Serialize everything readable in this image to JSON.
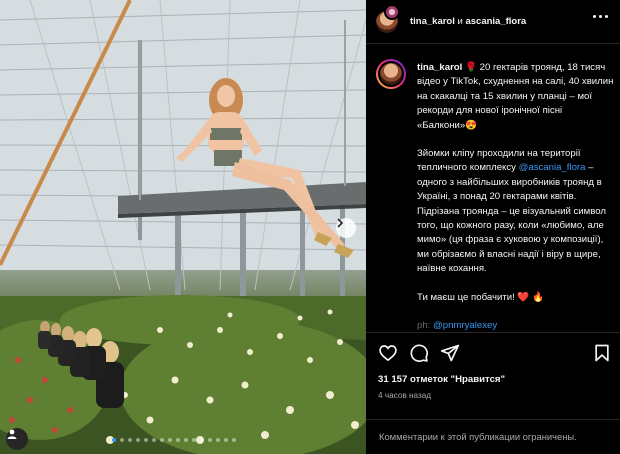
{
  "header": {
    "user1": "tina_karol",
    "conjunction": "и",
    "user2": "ascania_flora",
    "more_icon": "more-horizontal-icon"
  },
  "caption": {
    "username": "tina_karol",
    "paragraph1": " 20 гектарів троянд, 18 тисяч відео у TikTok, схуднення на салі, 40 хвилин на скакалці та 15 хвилин у планці – мої рекорди для нової іронічної пісні «Балкони»😍",
    "paragraph1_icon": "rose-icon",
    "paragraph2_part1": "Зйомки кліпу проходили на території тепличного комплексу ",
    "paragraph2_mention": "@ascania_flora",
    "paragraph2_part2": " – одного з найбільших виробників троянд в Україні, з понад 20 гектарами квітів. Підрізана троянда – це візуальний символ того, що кожного разу, коли «любимо, але мимо» (ця фраза є хуковою у композиції), ми обрізаємо й власні надії і віру в щире, наївне кохання.",
    "paragraph3": "Ти маєш це побачити! ❤️ 🔥",
    "credit_prefix": "ph: ",
    "credit_mention": "@pnmryalexey"
  },
  "actions": {
    "like_icon": "heart-icon",
    "comment_icon": "comment-icon",
    "share_icon": "send-icon",
    "save_icon": "bookmark-icon"
  },
  "likes_text": "31 157 отметок \"Нравится\"",
  "time_text": "4 часов назад",
  "comments_disabled_text": "Комментарии к этой публикации ограничены.",
  "carousel": {
    "slide_count": 16,
    "active_index": 0,
    "next_icon": "chevron-right-icon",
    "tag_icon": "person-tag-icon"
  },
  "colors": {
    "background": "#000000",
    "text": "#f5f5f5",
    "secondary": "#a8a8a8",
    "link": "#3897f0",
    "border": "#262626"
  }
}
